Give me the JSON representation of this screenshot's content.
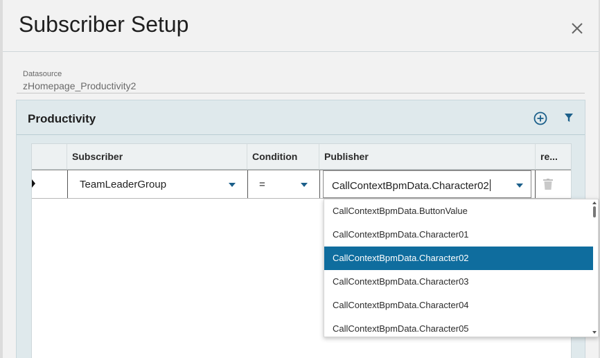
{
  "dialog": {
    "title": "Subscriber Setup",
    "close_icon": "close-icon"
  },
  "datasource": {
    "label": "Datasource",
    "value": "zHomepage_Productivity2"
  },
  "panel": {
    "title": "Productivity",
    "add_icon": "plus-circle-icon",
    "filter_icon": "filter-icon",
    "accent_color": "#1b5f8a"
  },
  "grid": {
    "columns": [
      "Subscriber",
      "Condition",
      "Publisher",
      "re..."
    ],
    "row": {
      "subscriber": "TeamLeaderGroup",
      "condition": "=",
      "publisher": "CallContextBpmData.Character02",
      "remove_icon": "trash-icon"
    }
  },
  "dropdown": {
    "options": [
      "CallContextBpmData.ButtonValue",
      "CallContextBpmData.Character01",
      "CallContextBpmData.Character02",
      "CallContextBpmData.Character03",
      "CallContextBpmData.Character04",
      "CallContextBpmData.Character05"
    ],
    "selected": "CallContextBpmData.Character02",
    "selected_color": "#0f6d9e"
  }
}
